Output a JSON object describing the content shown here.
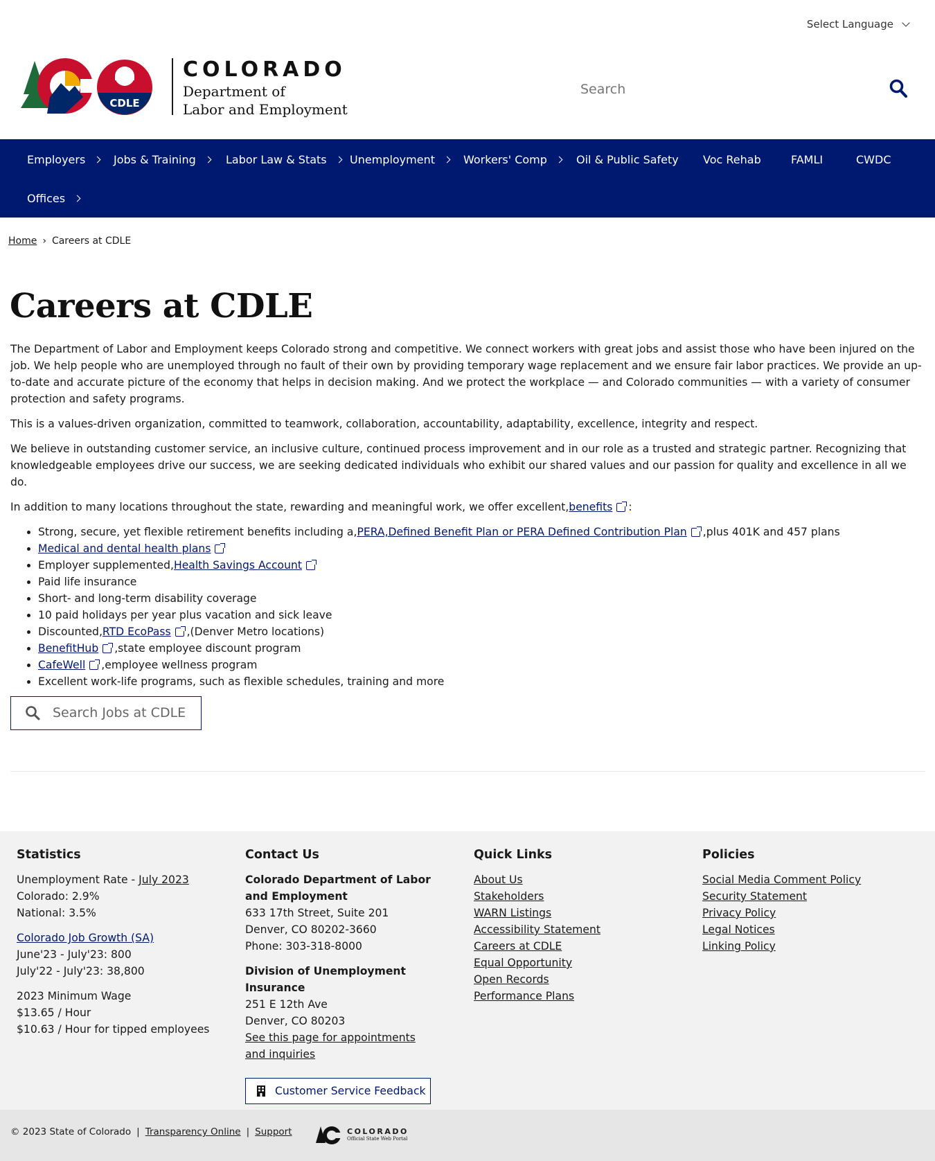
{
  "language": {
    "label": "Select Language"
  },
  "header": {
    "state": "COLORADO",
    "dept_line1": "Department of",
    "dept_line2": "Labor and Employment",
    "logo_badge": "CDLE",
    "search_placeholder": "Search"
  },
  "nav": {
    "items": [
      {
        "label": "Employers"
      },
      {
        "label": "Jobs & Training"
      },
      {
        "label": "Labor Law & Stats"
      },
      {
        "label": "Unemployment"
      },
      {
        "label": "Workers' Comp"
      },
      {
        "label": "Oil & Public Safety"
      },
      {
        "label": "Voc Rehab"
      },
      {
        "label": "FAMLI"
      },
      {
        "label": "CWDC"
      },
      {
        "label": "Offices"
      }
    ]
  },
  "breadcrumb": {
    "home": "Home",
    "separator": "›",
    "current": "Careers at CDLE"
  },
  "page": {
    "title": "Careers at CDLE",
    "p1": "The Department of Labor and Employment keeps Colorado strong and competitive. We connect workers with great jobs and assist those who have been injured on the job. We help people who are unemployed through no fault of their own by providing temporary wage replacement and we ensure fair labor practices. We provide an up-to-date and accurate picture of the economy that helps in decision making. And we protect the workplace — and Colorado communities — with a variety of consumer protection and safety programs.",
    "p2": "This is a values-driven organization, committed to teamwork, collaboration, accountability, adaptability, excellence, integrity and respect.",
    "p3": "We believe in outstanding customer service, an inclusive culture, continued process improvement and in our role as a trusted and strategic partner. Recognizing that knowledgeable employees drive our success, we are seeking dedicated individuals who exhibit our shared values and our passion for quality and excellence in all we do.",
    "p4_pre": "In addition to many locations throughout the state, rewarding and meaningful work, we offer excellent,",
    "p4_link": "benefits",
    "p4_post": ":",
    "benefits": {
      "b1_pre": "Strong, secure, yet flexible retirement benefits including a,",
      "b1_link": "PERA,Defined Benefit Plan or PERA Defined Contribution Plan",
      "b1_post": ",plus 401K and 457 plans",
      "b2_link": "Medical and dental health plans",
      "b3_pre": "Employer supplemented,",
      "b3_link": "Health Savings Account",
      "b4": "Paid life insurance",
      "b5": "Short- and long-term disability coverage",
      "b6": "10 paid holidays per year plus vacation and sick leave",
      "b7_pre": "Discounted,",
      "b7_link": "RTD EcoPass",
      "b7_post": ",(Denver Metro locations)",
      "b8_link": "BenefitHub",
      "b8_post": ",state employee discount program",
      "b9_link": "CafeWell",
      "b9_post": ",employee wellness program",
      "b10": "Excellent work-life programs, such as flexible schedules, training and more"
    },
    "job_search_placeholder": "Search Jobs at CDLE"
  },
  "footer": {
    "statistics": {
      "heading": "Statistics",
      "unemp_label": "Unemployment Rate - ",
      "unemp_link": "July 2023",
      "colorado": "Colorado: 2.9%",
      "national": "National: 3.5%",
      "growth_link": "Colorado Job Growth (SA)",
      "growth1": "June'23 - July'23: 800",
      "growth2": "July'22 - July'23: 38,800",
      "wage_title": "2023 Minimum Wage",
      "wage1": "$13.65 / Hour",
      "wage2": "$10.63 / Hour for tipped employees"
    },
    "contact": {
      "heading": "Contact Us",
      "org1": "Colorado Department of Labor and Employment",
      "addr1": "633 17th Street, Suite 201",
      "city1": "Denver, CO  80202-3660",
      "phone": "Phone: 303-318-8000",
      "org2": "Division of Unemployment Insurance",
      "addr2": "251 E 12th Ave",
      "city2": "Denver, CO  80203",
      "appt_link": "See this page for appointments and inquiries",
      "feedback": "Customer Service Feedback"
    },
    "quick_links": {
      "heading": "Quick Links",
      "items": [
        "About Us",
        "Stakeholders",
        "WARN Listings",
        "Accessibility Statement",
        "Careers at CDLE",
        "Equal Opportunity",
        "Open Records",
        "Performance Plans"
      ]
    },
    "policies": {
      "heading": "Policies",
      "items": [
        "Social Media Comment Policy",
        "Security Statement",
        "Privacy Policy",
        "Legal Notices",
        "Linking Policy"
      ]
    }
  },
  "bottom": {
    "copyright": "© 2023 State of Colorado",
    "sep": "|",
    "transparency": "Transparency Online",
    "support": "Support",
    "portal_name": "COLORADO",
    "portal_sub": "Official State Web Portal"
  },
  "colors": {
    "nav_bg": "#001970",
    "link": "#001970"
  }
}
